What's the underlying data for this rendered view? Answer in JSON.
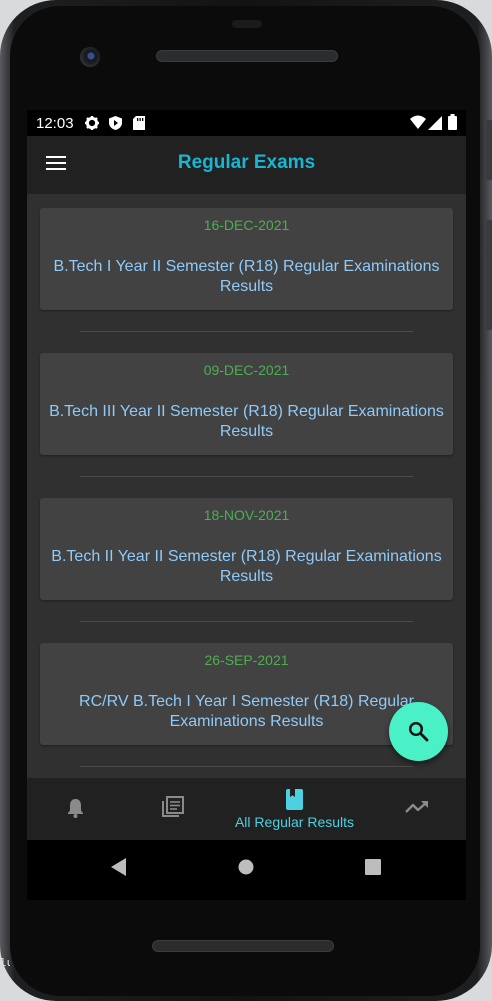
{
  "status_bar": {
    "time": "12:03",
    "icons": [
      "settings-icon",
      "shield-icon",
      "sd-card-icon",
      "wifi-icon",
      "signal-icon",
      "battery-icon"
    ]
  },
  "app_bar": {
    "title": "Regular Exams",
    "menu_icon": "menu-icon"
  },
  "results": [
    {
      "date": "16-DEC-2021",
      "title": "B.Tech I Year II Semester (R18) Regular Examinations Results"
    },
    {
      "date": "09-DEC-2021",
      "title": "B.Tech III Year II Semester (R18) Regular Examinations Results"
    },
    {
      "date": "18-NOV-2021",
      "title": "B.Tech II Year II Semester (R18) Regular Examinations Results"
    },
    {
      "date": "26-SEP-2021",
      "title": "RC/RV B.Tech I Year I Semester (R18) Regular Examinations Results"
    }
  ],
  "fab": {
    "icon": "search-icon"
  },
  "bottom_nav": {
    "items": [
      {
        "icon": "bell-icon",
        "label": ""
      },
      {
        "icon": "library-books-icon",
        "label": ""
      },
      {
        "icon": "book-icon",
        "label": "All Regular Results",
        "selected": true
      },
      {
        "icon": "trending-up-icon",
        "label": ""
      }
    ]
  },
  "system_nav": {
    "icons": [
      "back-icon",
      "home-icon",
      "recents-icon"
    ]
  },
  "edge_text": "lu",
  "colors": {
    "accent": "#17b6d2",
    "date_green": "#4caf50",
    "title_blue": "#90caf9",
    "fab": "#4af0c6",
    "selected_nav": "#4dd0e1",
    "card": "#424242",
    "background": "#303030"
  }
}
